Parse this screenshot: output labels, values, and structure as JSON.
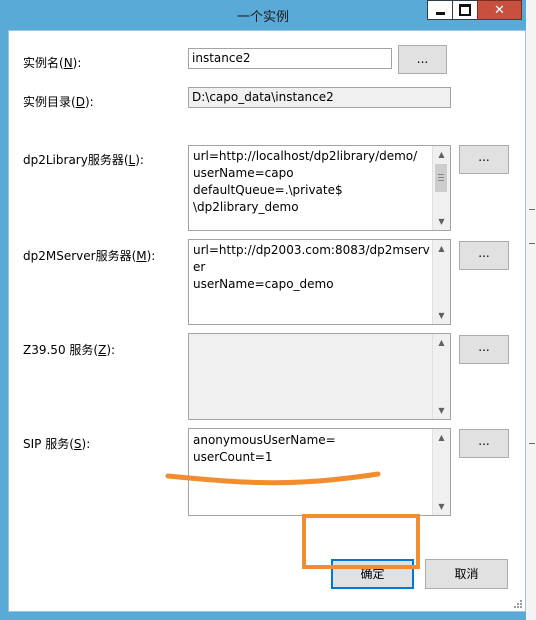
{
  "window": {
    "title": "一个实例",
    "minimize_icon": "minimize-icon",
    "maximize_icon": "maximize-icon",
    "close_glyph": "✕"
  },
  "fields": {
    "instance_name": {
      "label_pre": "实例名(",
      "hotkey": "N",
      "label_post": "):",
      "value": "instance2",
      "browse": "..."
    },
    "instance_dir": {
      "label_pre": "实例目录(",
      "hotkey": "D",
      "label_post": "):",
      "value": "D:\\capo_data\\instance2"
    },
    "dp2library": {
      "label_pre": "dp2Library服务器(",
      "hotkey": "L",
      "label_post": "):",
      "lines": [
        "url=http://localhost/dp2library/demo/",
        "userName=capo",
        "defaultQueue=.\\private$",
        "\\dp2library_demo"
      ],
      "browse": "..."
    },
    "dp2mserver": {
      "label_pre": "dp2MServer服务器(",
      "hotkey": "M",
      "label_post": "):",
      "lines": [
        "url=http://dp2003.com:8083/dp2mserver",
        "userName=capo_demo"
      ],
      "browse": "..."
    },
    "z3950": {
      "label_pre": "Z39.50 服务(",
      "hotkey": "Z",
      "label_post": "):",
      "lines": [],
      "browse": "..."
    },
    "sip": {
      "label_pre": "SIP 服务(",
      "hotkey": "S",
      "label_post": "):",
      "lines": [
        "anonymousUserName=",
        "userCount=1"
      ],
      "browse": "..."
    }
  },
  "buttons": {
    "ok": "确定",
    "cancel": "取消"
  },
  "colors": {
    "titlebar": "#5aaad8",
    "close": "#c7503f",
    "highlight": "#f28d2f",
    "focus": "#0078d7"
  }
}
